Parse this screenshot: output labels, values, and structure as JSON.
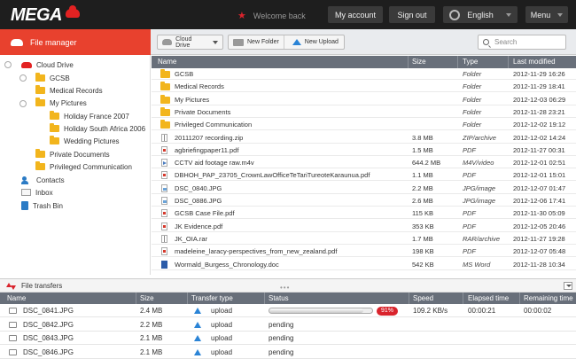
{
  "header": {
    "brand": "MEGA",
    "welcome": "Welcome back",
    "my_account": "My account",
    "sign_out": "Sign out",
    "language": "English",
    "menu": "Menu"
  },
  "sidebar": {
    "title": "File manager",
    "items": [
      {
        "label": "Cloud Drive"
      },
      {
        "label": "GCSB"
      },
      {
        "label": "Medical Records"
      },
      {
        "label": "My Pictures"
      },
      {
        "label": "Holiday France 2007"
      },
      {
        "label": "Holiday South Africa 2006"
      },
      {
        "label": "Wedding Pictures"
      },
      {
        "label": "Private Documents"
      },
      {
        "label": "Privileged Communication"
      },
      {
        "label": "Contacts"
      },
      {
        "label": "Inbox"
      },
      {
        "label": "Trash Bin"
      }
    ]
  },
  "toolbar": {
    "cloud_drive": "Cloud Drive",
    "new_folder": "New Folder",
    "new_upload": "New Upload",
    "search_placeholder": "Search"
  },
  "files": {
    "headers": {
      "name": "Name",
      "size": "Size",
      "type": "Type",
      "modified": "Last modified"
    },
    "rows": [
      {
        "icon": "folder-icon",
        "name": "GCSB",
        "size": "",
        "type": "Folder",
        "modified": "2012-11-29 16:26"
      },
      {
        "icon": "folder-icon",
        "name": "Medical Records",
        "size": "",
        "type": "Folder",
        "modified": "2012-11-29 18:41"
      },
      {
        "icon": "folder-icon",
        "name": "My Pictures",
        "size": "",
        "type": "Folder",
        "modified": "2012-12-03 06:29"
      },
      {
        "icon": "folder-icon",
        "name": "Private Documents",
        "size": "",
        "type": "Folder",
        "modified": "2012-11-28 23:21"
      },
      {
        "icon": "folder-icon",
        "name": "Privileged Communication",
        "size": "",
        "type": "Folder",
        "modified": "2012-12-02 19:12"
      },
      {
        "icon": "zip-icon",
        "name": "20111207 recording.zip",
        "size": "3.8 MB",
        "type": "ZIP/archive",
        "modified": "2012-12-02 14:24"
      },
      {
        "icon": "pdf-icon",
        "name": "agbriefingpaper11.pdf",
        "size": "1.5 MB",
        "type": "PDF",
        "modified": "2012-11-27 00:31"
      },
      {
        "icon": "video-icon",
        "name": "CCTV aid footage raw.m4v",
        "size": "644.2 MB",
        "type": "M4V/video",
        "modified": "2012-12-01 02:51"
      },
      {
        "icon": "pdf-icon",
        "name": "DBHOH_PAP_23705_CrownLawOfficeTeTariTureoteKaraunua.pdf",
        "size": "1.1 MB",
        "type": "PDF",
        "modified": "2012-12-01 15:01"
      },
      {
        "icon": "image-icon",
        "name": "DSC_0840.JPG",
        "size": "2.2 MB",
        "type": "JPG/image",
        "modified": "2012-12-07 01:47"
      },
      {
        "icon": "image-icon",
        "name": "DSC_0886.JPG",
        "size": "2.6 MB",
        "type": "JPG/image",
        "modified": "2012-12-06 17:41"
      },
      {
        "icon": "pdf-icon",
        "name": "GCSB Case File.pdf",
        "size": "115 KB",
        "type": "PDF",
        "modified": "2012-11-30 05:09"
      },
      {
        "icon": "pdf-icon",
        "name": "JK Evidence.pdf",
        "size": "353 KB",
        "type": "PDF",
        "modified": "2012-12-05 20:46"
      },
      {
        "icon": "zip-icon",
        "name": "JK_OIA.rar",
        "size": "1.7 MB",
        "type": "RAR/archive",
        "modified": "2012-11-27 19:28"
      },
      {
        "icon": "pdf-icon",
        "name": "madeleine_laracy-perspectives_from_new_zealand.pdf",
        "size": "198 KB",
        "type": "PDF",
        "modified": "2012-12-07 05:48"
      },
      {
        "icon": "word-icon",
        "name": "Wormald_Burgess_Chronology.doc",
        "size": "542 KB",
        "type": "MS Word",
        "modified": "2012-11-28 10:34"
      }
    ]
  },
  "transfers": {
    "title": "File transfers",
    "headers": {
      "name": "Name",
      "size": "Size",
      "type": "Transfer type",
      "status": "Status",
      "speed": "Speed",
      "elapsed": "Elapsed time",
      "remaining": "Remaining time"
    },
    "rows": [
      {
        "name": "DSC_0841.JPG",
        "size": "2.4 MB",
        "type": "upload",
        "status": "",
        "progress": 0.91,
        "percent": "91%",
        "speed": "109.2 KB/s",
        "elapsed": "00:00:21",
        "remaining": "00:00:02"
      },
      {
        "name": "DSC_0842.JPG",
        "size": "2.2 MB",
        "type": "upload",
        "status": "pending",
        "speed": "",
        "elapsed": "",
        "remaining": ""
      },
      {
        "name": "DSC_0843.JPG",
        "size": "2.1 MB",
        "type": "upload",
        "status": "pending",
        "speed": "",
        "elapsed": "",
        "remaining": ""
      },
      {
        "name": "DSC_0846.JPG",
        "size": "2.1 MB",
        "type": "upload",
        "status": "pending",
        "speed": "",
        "elapsed": "",
        "remaining": ""
      }
    ]
  },
  "colors": {
    "brand_red": "#d9232c",
    "header_bg": "#1e1e1e",
    "table_header": "#686f7a",
    "accent_blue": "#2b84d6"
  }
}
